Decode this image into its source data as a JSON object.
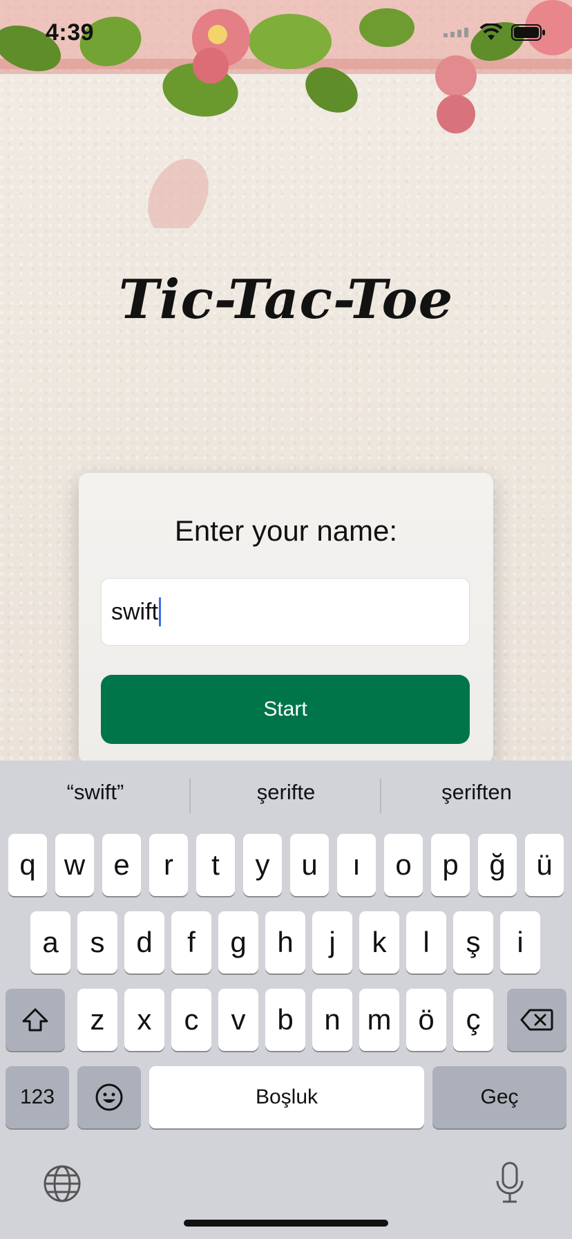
{
  "status": {
    "time": "4:39"
  },
  "app": {
    "title": "Tic-Tac-Toe"
  },
  "form": {
    "label": "Enter your name:",
    "name_value": "swift",
    "start_label": "Start"
  },
  "keyboard": {
    "suggestions": [
      "“swift”",
      "şerifte",
      "şeriften"
    ],
    "row1": [
      "q",
      "w",
      "e",
      "r",
      "t",
      "y",
      "u",
      "ı",
      "o",
      "p",
      "ğ",
      "ü"
    ],
    "row2": [
      "a",
      "s",
      "d",
      "f",
      "g",
      "h",
      "j",
      "k",
      "l",
      "ş",
      "i"
    ],
    "row3": [
      "z",
      "x",
      "c",
      "v",
      "b",
      "n",
      "m",
      "ö",
      "ç"
    ],
    "numbers_label": "123",
    "space_label": "Boşluk",
    "return_label": "Geç"
  },
  "colors": {
    "start_button": "#00754a",
    "caret": "#3b6fe0"
  }
}
